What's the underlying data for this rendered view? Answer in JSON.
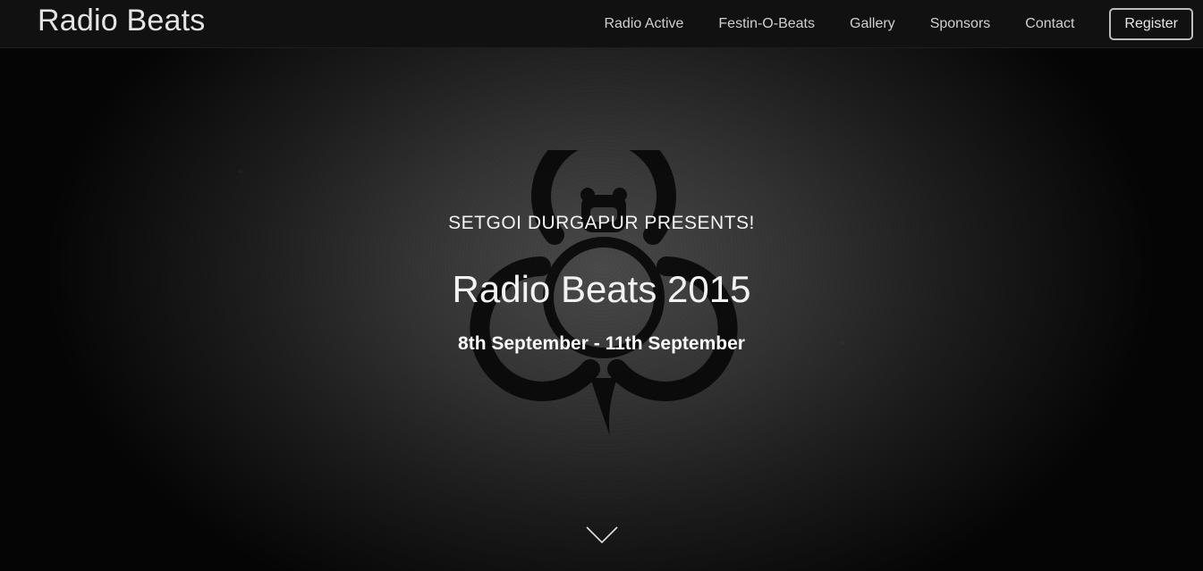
{
  "navbar": {
    "brand": "Radio Beats",
    "links": [
      {
        "label": "Radio Active"
      },
      {
        "label": "Festin-O-Beats"
      },
      {
        "label": "Gallery"
      },
      {
        "label": "Sponsors"
      },
      {
        "label": "Contact"
      }
    ],
    "register_label": "Register"
  },
  "hero": {
    "presents": "SETGOI DURGAPUR PRESENTS!",
    "title": "Radio Beats 2015",
    "dates": "8th September - 11th September",
    "emblem_icon": "biohazard-icon",
    "scroll_icon": "chevron-down-icon"
  },
  "colors": {
    "navbar_bg": "#111111",
    "hero_bg": "#2e2e2e",
    "text": "#f2f2f2"
  }
}
